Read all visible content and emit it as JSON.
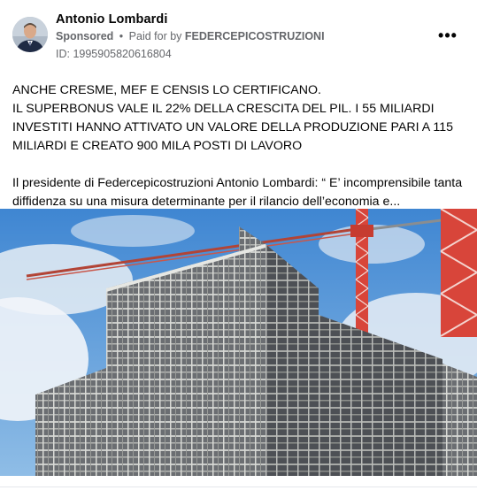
{
  "post": {
    "author": "Antonio Lombardi",
    "sponsored_label": "Sponsored",
    "separator": "•",
    "paid_for_prefix": "Paid for by",
    "sponsor": "FEDERCEPICOSTRUZIONI",
    "id_label": "ID: 1995905820616804",
    "more_icon": "more-options-icon",
    "headline_lines": [
      "ANCHE CRESME, MEF E CENSIS LO CERTIFICANO.",
      "IL SUPERBONUS VALE IL 22% DELLA CRESCITA DEL PIL. I 55 MILIARDI INVESTITI HANNO ATTIVATO UN VALORE DELLA PRODUZIONE PARI A 115 MILIARDI E CREATO 900 MILA POSTI DI LAVORO"
    ],
    "paragraph": "Il presidente di Federcepicostruzioni Antonio Lombardi: “ E’ incomprensibile tanta diffidenza su una misura determinante per il rilancio dell’economia e..."
  },
  "colors": {
    "text": "#050505",
    "muted": "#65676b",
    "sky": "#4a8fd6",
    "crane": "#d8453a"
  }
}
